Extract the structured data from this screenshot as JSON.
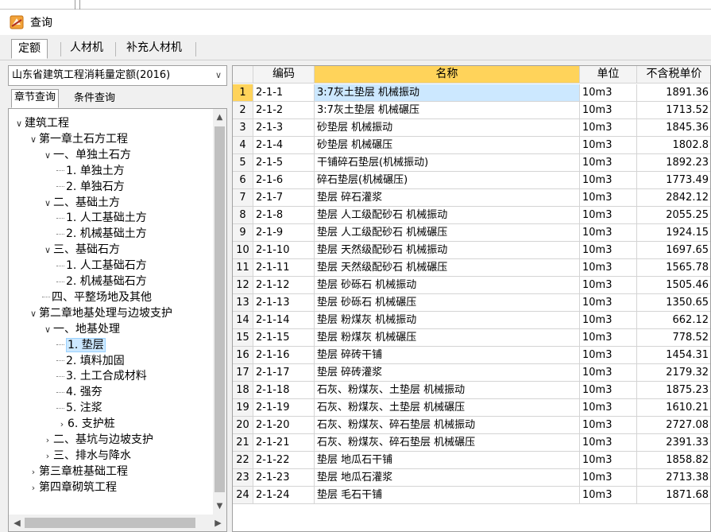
{
  "window": {
    "title": "查询"
  },
  "tabs": [
    "定额",
    "人材机",
    "补充人材机"
  ],
  "left": {
    "quota_library": "山东省建筑工程消耗量定额(2016)",
    "subtabs": [
      "章节查询",
      "条件查询"
    ],
    "tree": [
      {
        "label": "建筑工程",
        "level": 0,
        "toggle": "expanded"
      },
      {
        "label": "第一章土石方工程",
        "level": 1,
        "toggle": "expanded"
      },
      {
        "label": "一、单独土石方",
        "level": 2,
        "toggle": "expanded"
      },
      {
        "label": "1. 单独土方",
        "level": 3,
        "toggle": "leaf"
      },
      {
        "label": "2. 单独石方",
        "level": 3,
        "toggle": "leaf"
      },
      {
        "label": "二、基础土方",
        "level": 2,
        "toggle": "expanded"
      },
      {
        "label": "1. 人工基础土方",
        "level": 3,
        "toggle": "leaf"
      },
      {
        "label": "2. 机械基础土方",
        "level": 3,
        "toggle": "leaf"
      },
      {
        "label": "三、基础石方",
        "level": 2,
        "toggle": "expanded"
      },
      {
        "label": "1. 人工基础石方",
        "level": 3,
        "toggle": "leaf"
      },
      {
        "label": "2. 机械基础石方",
        "level": 3,
        "toggle": "leaf"
      },
      {
        "label": "四、平整场地及其他",
        "level": 2,
        "toggle": "leaf"
      },
      {
        "label": "第二章地基处理与边坡支护",
        "level": 1,
        "toggle": "expanded"
      },
      {
        "label": "一、地基处理",
        "level": 2,
        "toggle": "expanded"
      },
      {
        "label": "1. 垫层",
        "level": 3,
        "toggle": "leaf",
        "selected": true
      },
      {
        "label": "2. 填料加固",
        "level": 3,
        "toggle": "leaf"
      },
      {
        "label": "3. 土工合成材料",
        "level": 3,
        "toggle": "leaf"
      },
      {
        "label": "4. 强夯",
        "level": 3,
        "toggle": "leaf"
      },
      {
        "label": "5. 注浆",
        "level": 3,
        "toggle": "leaf"
      },
      {
        "label": "6. 支护桩",
        "level": 3,
        "toggle": "collapsed"
      },
      {
        "label": "二、基坑与边坡支护",
        "level": 2,
        "toggle": "collapsed"
      },
      {
        "label": "三、排水与降水",
        "level": 2,
        "toggle": "collapsed"
      },
      {
        "label": "第三章桩基础工程",
        "level": 1,
        "toggle": "collapsed"
      },
      {
        "label": "第四章砌筑工程",
        "level": 1,
        "toggle": "collapsed"
      }
    ]
  },
  "grid": {
    "columns": [
      "编码",
      "名称",
      "单位",
      "不含税单价"
    ],
    "rows": [
      [
        "1",
        "2-1-1",
        "3:7灰土垫层 机械振动",
        "10m3",
        "1891.36"
      ],
      [
        "2",
        "2-1-2",
        "3:7灰土垫层 机械碾压",
        "10m3",
        "1713.52"
      ],
      [
        "3",
        "2-1-3",
        "砂垫层 机械振动",
        "10m3",
        "1845.36"
      ],
      [
        "4",
        "2-1-4",
        "砂垫层 机械碾压",
        "10m3",
        "1802.8"
      ],
      [
        "5",
        "2-1-5",
        "干铺碎石垫层(机械振动)",
        "10m3",
        "1892.23"
      ],
      [
        "6",
        "2-1-6",
        "碎石垫层(机械碾压)",
        "10m3",
        "1773.49"
      ],
      [
        "7",
        "2-1-7",
        "垫层 碎石灌浆",
        "10m3",
        "2842.12"
      ],
      [
        "8",
        "2-1-8",
        "垫层 人工级配砂石 机械振动",
        "10m3",
        "2055.25"
      ],
      [
        "9",
        "2-1-9",
        "垫层 人工级配砂石 机械碾压",
        "10m3",
        "1924.15"
      ],
      [
        "10",
        "2-1-10",
        "垫层 天然级配砂石 机械振动",
        "10m3",
        "1697.65"
      ],
      [
        "11",
        "2-1-11",
        "垫层 天然级配砂石 机械碾压",
        "10m3",
        "1565.78"
      ],
      [
        "12",
        "2-1-12",
        "垫层 砂砾石 机械振动",
        "10m3",
        "1505.46"
      ],
      [
        "13",
        "2-1-13",
        "垫层 砂砾石 机械碾压",
        "10m3",
        "1350.65"
      ],
      [
        "14",
        "2-1-14",
        "垫层 粉煤灰 机械振动",
        "10m3",
        "662.12"
      ],
      [
        "15",
        "2-1-15",
        "垫层 粉煤灰 机械碾压",
        "10m3",
        "778.52"
      ],
      [
        "16",
        "2-1-16",
        "垫层 碎砖干铺",
        "10m3",
        "1454.31"
      ],
      [
        "17",
        "2-1-17",
        "垫层 碎砖灌浆",
        "10m3",
        "2179.32"
      ],
      [
        "18",
        "2-1-18",
        "石灰、粉煤灰、土垫层 机械振动",
        "10m3",
        "1875.23"
      ],
      [
        "19",
        "2-1-19",
        "石灰、粉煤灰、土垫层 机械碾压",
        "10m3",
        "1610.21"
      ],
      [
        "20",
        "2-1-20",
        "石灰、粉煤灰、碎石垫层 机械振动",
        "10m3",
        "2727.08"
      ],
      [
        "21",
        "2-1-21",
        "石灰、粉煤灰、碎石垫层 机械碾压",
        "10m3",
        "2391.33"
      ],
      [
        "22",
        "2-1-22",
        "垫层 地瓜石干铺",
        "10m3",
        "1858.82"
      ],
      [
        "23",
        "2-1-23",
        "垫层 地瓜石灌浆",
        "10m3",
        "2713.38"
      ],
      [
        "24",
        "2-1-24",
        "垫层 毛石干铺",
        "10m3",
        "1871.68"
      ]
    ]
  }
}
